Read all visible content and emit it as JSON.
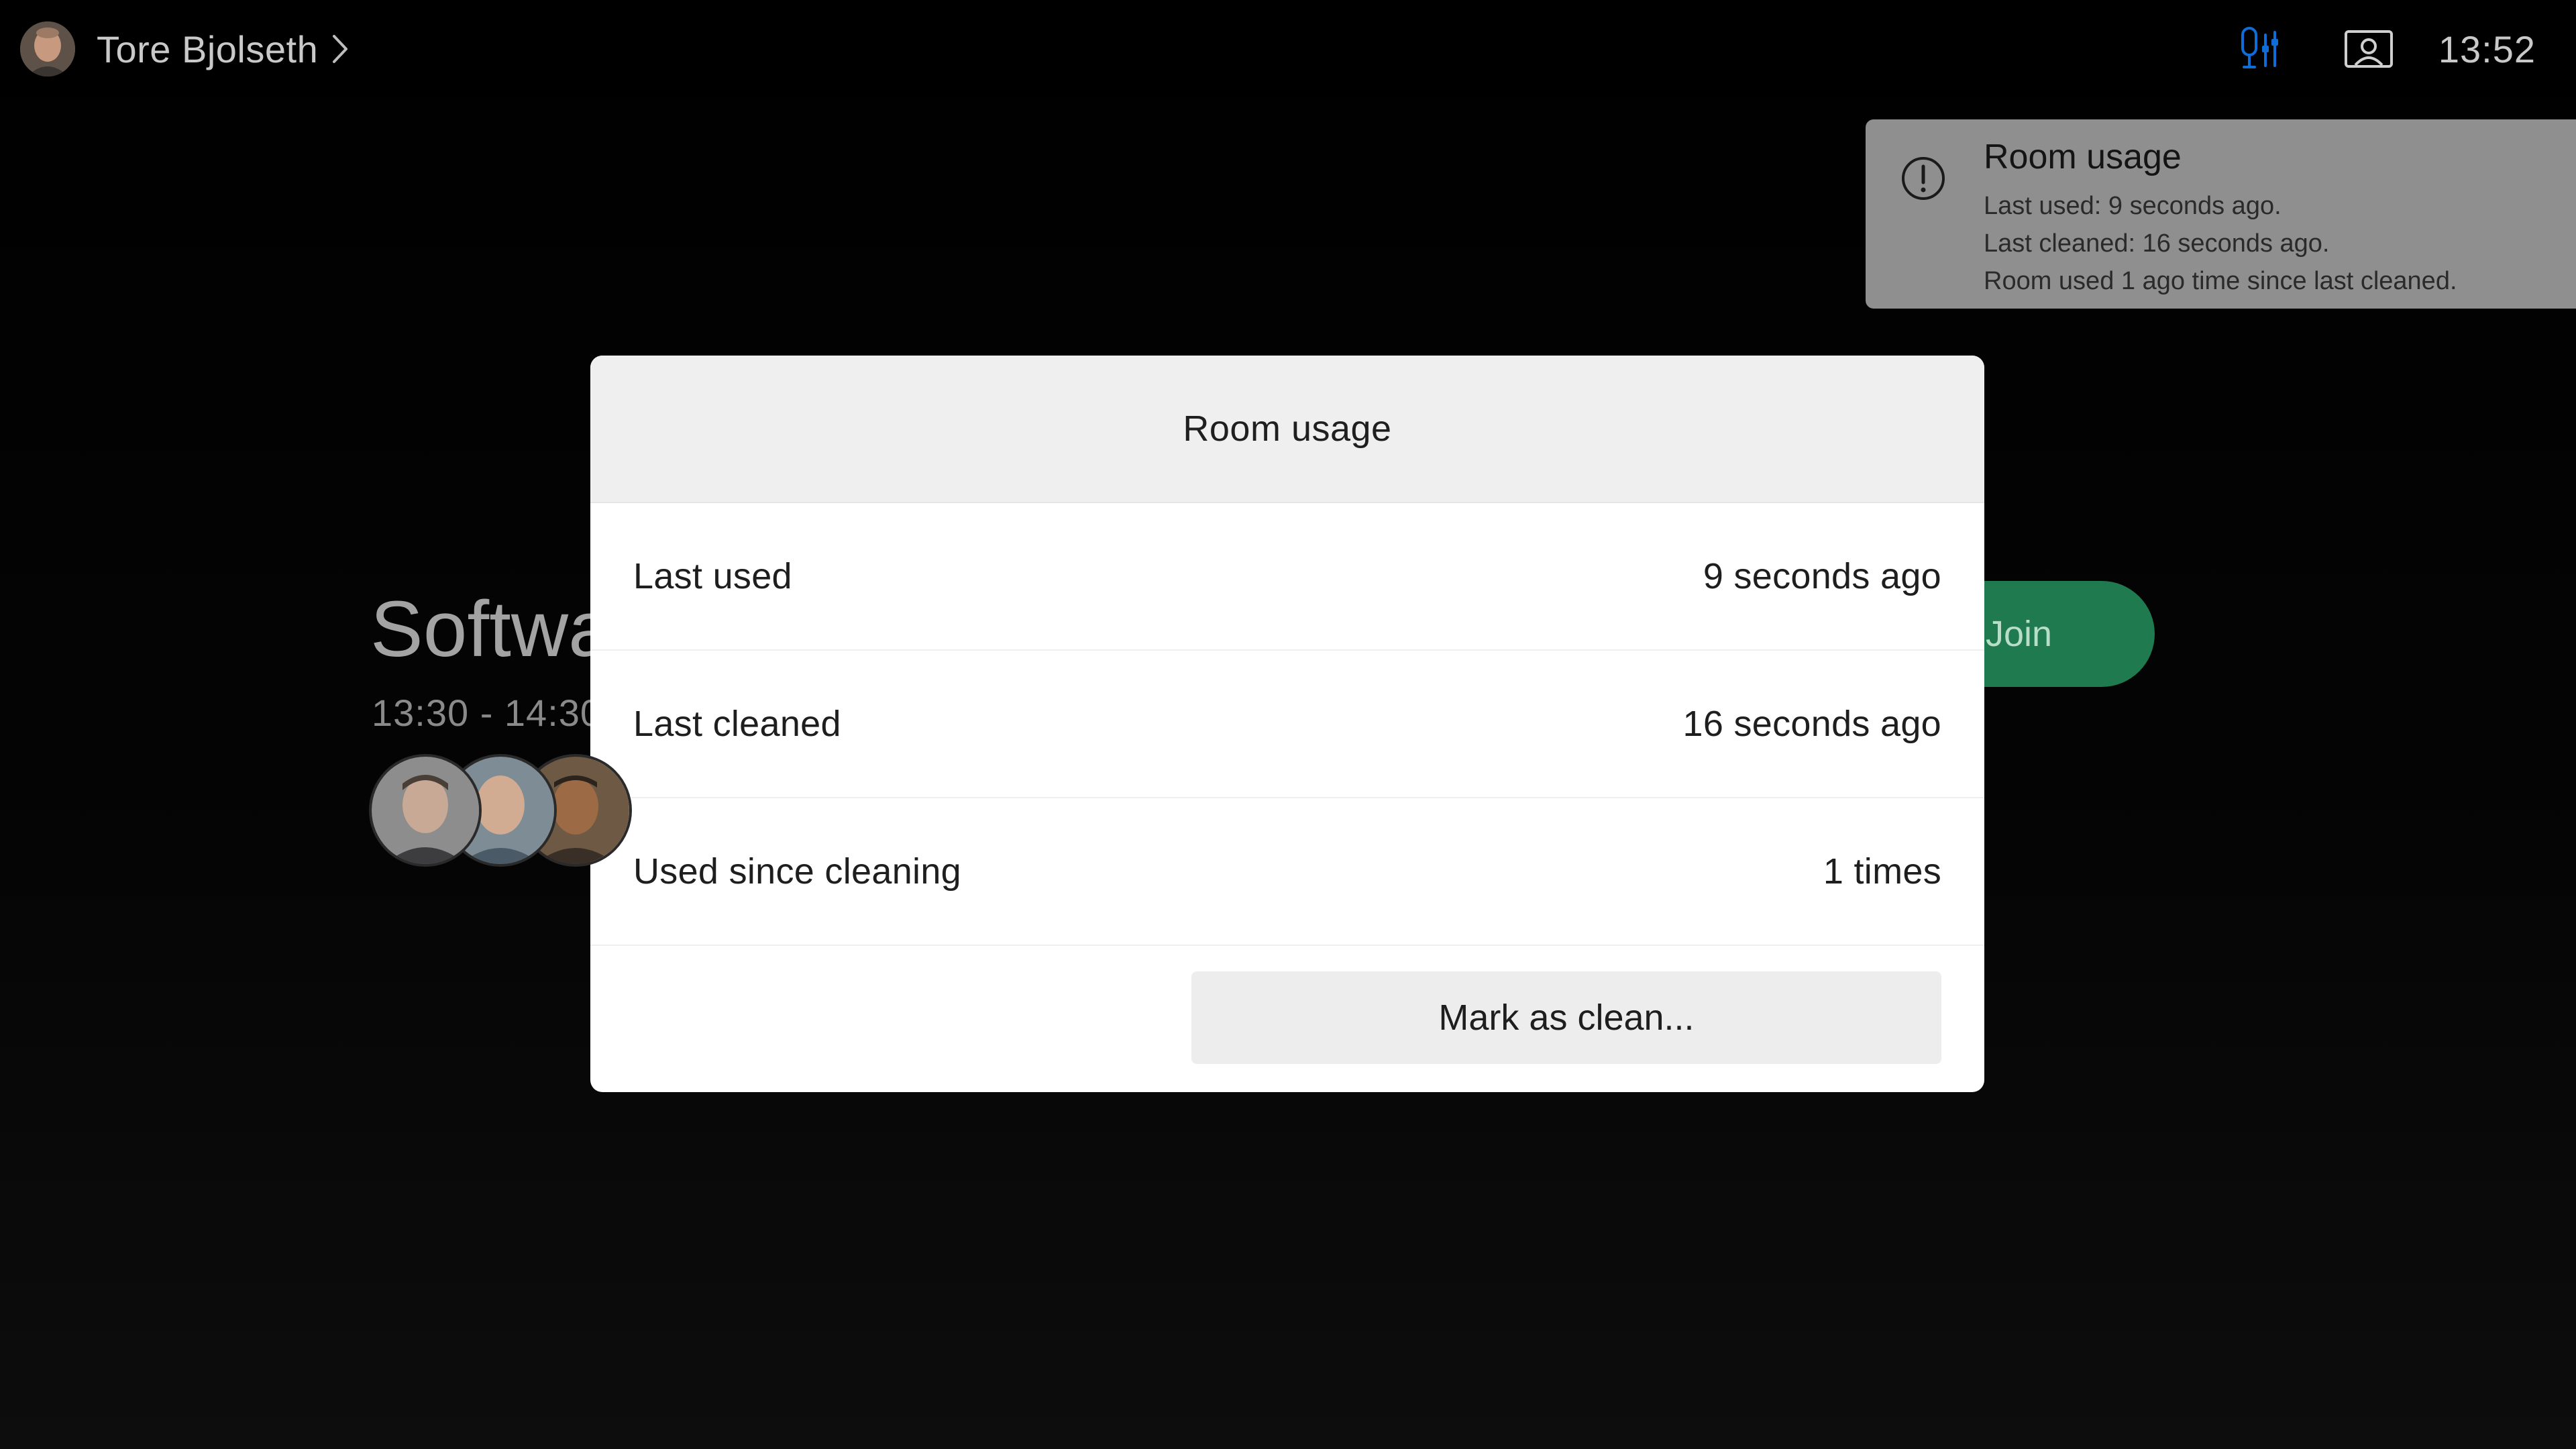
{
  "header": {
    "user_name": "Tore Bjolseth",
    "clock": "13:52"
  },
  "icons": {
    "user_chevron": "chevron-right-icon",
    "mic": "microphone-settings-icon",
    "camera": "self-view-icon",
    "toast": "info-exclamation-icon"
  },
  "colors": {
    "accent_blue": "#0e6dd6",
    "join_green": "#1f7a4f",
    "toast_bg": "#8f8f8f"
  },
  "toast": {
    "title": "Room usage",
    "line1": "Last used: 9 seconds ago.",
    "line2": "Last cleaned: 16 seconds ago.",
    "line3": "Room used 1 ago time since last cleaned."
  },
  "meeting": {
    "title": "Softwa",
    "time": "13:30 - 14:30",
    "join_label": "Join"
  },
  "modal": {
    "title": "Room usage",
    "rows": [
      {
        "label": "Last used",
        "value": "9 seconds ago"
      },
      {
        "label": "Last cleaned",
        "value": "16 seconds ago"
      },
      {
        "label": "Used since cleaning",
        "value": "1 times"
      }
    ],
    "button_label": "Mark as clean..."
  }
}
